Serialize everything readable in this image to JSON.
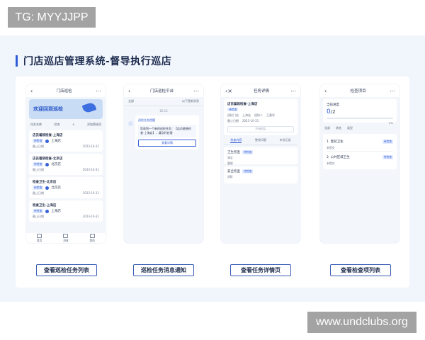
{
  "watermarks": {
    "top": "TG: MYYJJPP",
    "bottom": "www.undclubs.org"
  },
  "heading": "门店巡店管理系统-督导执行巡店",
  "screens": {
    "list": {
      "title": "门店巡检",
      "banner": "欢迎回到巡检",
      "filters": [
        "任务名称",
        "状态",
        "+",
        "添加筛选项"
      ],
      "cards": [
        {
          "title": "店员着装检查-上海店",
          "tag": "待检查",
          "store": "上海店",
          "foot_label": "截止日期",
          "date": "2023-10-31"
        },
        {
          "title": "店员着装检查-北京店",
          "tag": "待检查",
          "store": "北京店",
          "foot_label": "截止日期",
          "date": "2023-10-31"
        },
        {
          "title": "检查卫生-北京店",
          "tag": "待检查",
          "store": "北京店",
          "foot_label": "截止日期",
          "date": "2023-10-31"
        },
        {
          "title": "检查卫生-上海店",
          "tag": "待检查",
          "store": "上海店",
          "foot_label": "截止日期",
          "date": "2023-10-31"
        }
      ],
      "tabs": [
        "首页",
        "消息",
        "我的"
      ]
    },
    "message": {
      "title": "门店巡检平台",
      "tab_left": "全部",
      "tab_right": "以下是新消息",
      "date": "16:12",
      "card_head": "巡检任务提醒",
      "card_body": "您收到一个新的巡检任务：【店员着装检查-上海店】，请及时处理",
      "button": "查看详情"
    },
    "detail": {
      "title": "任务详情",
      "task_title": "店员着装检查-上海店",
      "tag": "待检查",
      "store_label": "巡检门店",
      "store": "上海店",
      "person_label": "巡检人",
      "person": "王督导",
      "deadline_label": "截止日期",
      "deadline": "2023-10-31",
      "input_placeholder": "开始巡店",
      "subtabs": [
        "检查内容",
        "整改问题",
        "申诉记录"
      ],
      "items": [
        {
          "name": "卫生检查",
          "tag": "待检查",
          "sub1": "清洁",
          "sub2": "整理"
        },
        {
          "name": "安全检查",
          "tag": "待检查",
          "sub1": "消防"
        }
      ]
    },
    "checklist": {
      "title": "检查项目",
      "progress_label": "当前进度",
      "done": "0",
      "total": "2",
      "percent": "0%",
      "progress_fraction": 0,
      "filters": [
        "全部",
        "状态",
        "类型"
      ],
      "items": [
        {
          "name": "1. 着装卫生",
          "tag": "待检查",
          "sub": "未提交"
        },
        {
          "name": "2. 公共区域卫生",
          "tag": "待检查",
          "sub": "未提交"
        }
      ]
    }
  },
  "captions": [
    "查看巡检任务列表",
    "巡检任务消息通知",
    "查看任务详情页",
    "查看检查项列表"
  ]
}
